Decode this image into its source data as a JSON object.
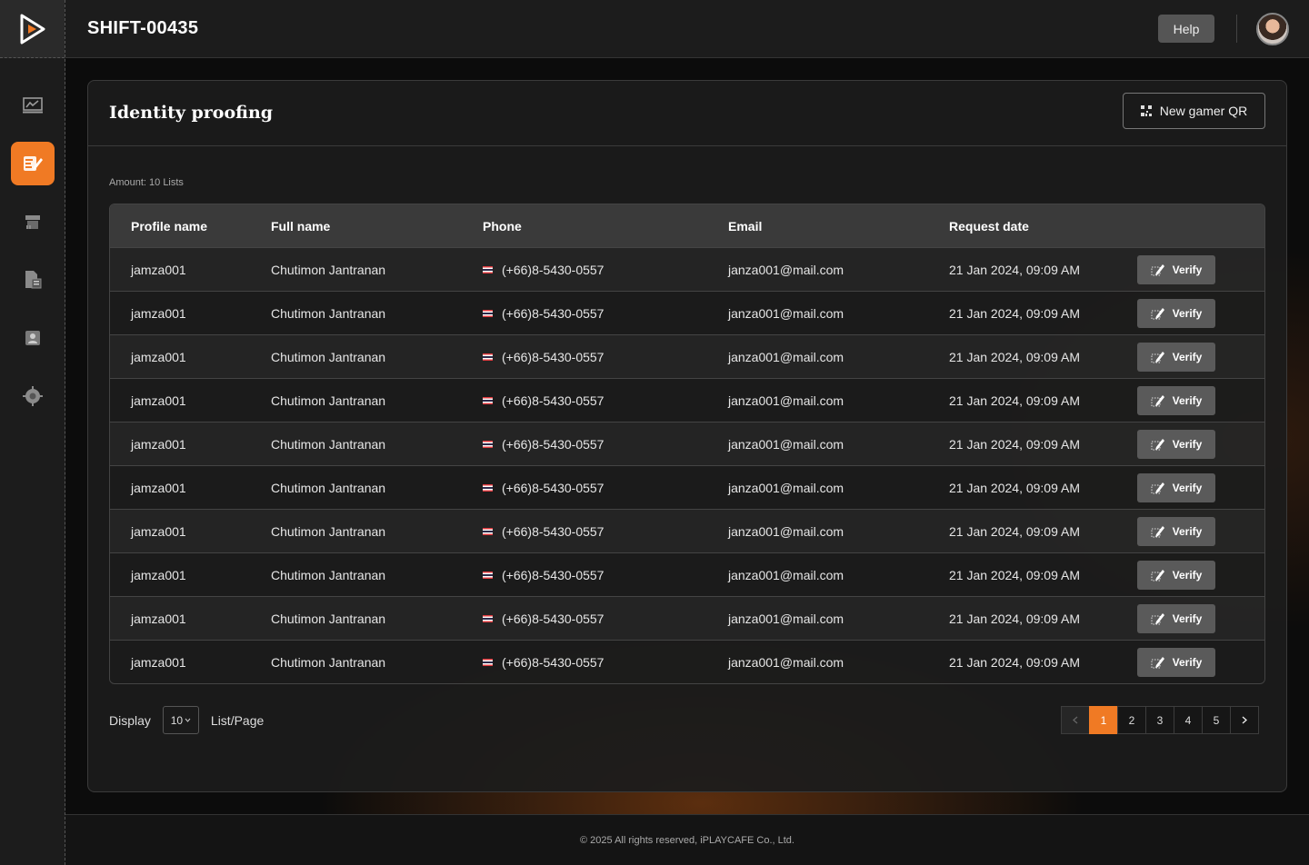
{
  "app": {
    "title": "SHIFT-00435",
    "help_label": "Help"
  },
  "panel": {
    "title": "Identity proofing",
    "qr_button": "New gamer QR",
    "amount": "Amount: 10 Lists"
  },
  "table": {
    "headers": [
      "Profile name",
      "Full name",
      "Phone",
      "Email",
      "Request date"
    ],
    "verify_label": "Verify",
    "rows": [
      {
        "profile": "jamza001",
        "fullname": "Chutimon Jantranan",
        "phone": "(+66)8-5430-0557",
        "email": "janza001@mail.com",
        "date": "21 Jan 2024, 09:09 AM"
      },
      {
        "profile": "jamza001",
        "fullname": "Chutimon Jantranan",
        "phone": "(+66)8-5430-0557",
        "email": "janza001@mail.com",
        "date": "21 Jan 2024, 09:09 AM"
      },
      {
        "profile": "jamza001",
        "fullname": "Chutimon Jantranan",
        "phone": "(+66)8-5430-0557",
        "email": "janza001@mail.com",
        "date": "21 Jan 2024, 09:09 AM"
      },
      {
        "profile": "jamza001",
        "fullname": "Chutimon Jantranan",
        "phone": "(+66)8-5430-0557",
        "email": "janza001@mail.com",
        "date": "21 Jan 2024, 09:09 AM"
      },
      {
        "profile": "jamza001",
        "fullname": "Chutimon Jantranan",
        "phone": "(+66)8-5430-0557",
        "email": "janza001@mail.com",
        "date": "21 Jan 2024, 09:09 AM"
      },
      {
        "profile": "jamza001",
        "fullname": "Chutimon Jantranan",
        "phone": "(+66)8-5430-0557",
        "email": "janza001@mail.com",
        "date": "21 Jan 2024, 09:09 AM"
      },
      {
        "profile": "jamza001",
        "fullname": "Chutimon Jantranan",
        "phone": "(+66)8-5430-0557",
        "email": "janza001@mail.com",
        "date": "21 Jan 2024, 09:09 AM"
      },
      {
        "profile": "jamza001",
        "fullname": "Chutimon Jantranan",
        "phone": "(+66)8-5430-0557",
        "email": "janza001@mail.com",
        "date": "21 Jan 2024, 09:09 AM"
      },
      {
        "profile": "jamza001",
        "fullname": "Chutimon Jantranan",
        "phone": "(+66)8-5430-0557",
        "email": "janza001@mail.com",
        "date": "21 Jan 2024, 09:09 AM"
      },
      {
        "profile": "jamza001",
        "fullname": "Chutimon Jantranan",
        "phone": "(+66)8-5430-0557",
        "email": "janza001@mail.com",
        "date": "21 Jan 2024, 09:09 AM"
      }
    ]
  },
  "pagination": {
    "display_label": "Display",
    "page_size": "10",
    "per_page_label": "List/Page",
    "pages": [
      "1",
      "2",
      "3",
      "4",
      "5"
    ],
    "current": "1"
  },
  "sidebar": {
    "items": [
      {
        "icon": "dashboard-chart-icon",
        "active": false
      },
      {
        "icon": "identity-proofing-icon",
        "active": true
      },
      {
        "icon": "store-icon",
        "active": false
      },
      {
        "icon": "document-report-icon",
        "active": false
      },
      {
        "icon": "member-card-icon",
        "active": false
      },
      {
        "icon": "settings-gear-icon",
        "active": false
      }
    ]
  },
  "footer": {
    "copyright": "© 2025 All rights reserved, iPLAYCAFE Co., Ltd."
  },
  "colors": {
    "accent": "#f07a24",
    "verify_bg": "#5a5a5a"
  }
}
